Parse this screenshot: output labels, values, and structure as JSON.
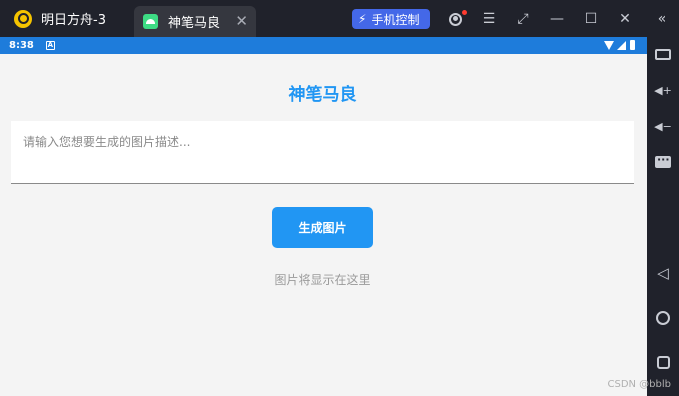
{
  "window": {
    "tabs": [
      {
        "label": "明日方舟-3"
      },
      {
        "label": "神笔马良"
      }
    ],
    "tab_close_glyph": "✕",
    "phone_control_label": "手机控制",
    "icons": [
      "user-icon",
      "menu-icon",
      "crop-icon",
      "minimize-icon",
      "maximize-icon",
      "close-icon",
      "collapse-icon"
    ]
  },
  "sidebar": {
    "icons": [
      "keyboard-icon",
      "volume-up-icon",
      "volume-down-icon",
      "more-icon",
      "back-icon",
      "home-icon",
      "recent-apps-icon"
    ]
  },
  "statusbar": {
    "time": "8:38",
    "badge": "A"
  },
  "app": {
    "title": "神笔马良",
    "input_placeholder": "请输入您想要生成的图片描述...",
    "generate_button": "生成图片",
    "image_placeholder": "图片将显示在这里"
  },
  "watermark": "CSDN @bblb",
  "colors": {
    "accent": "#2196f3",
    "statusbar": "#1e7cdb",
    "chrome": "#20222b",
    "phone_control": "#4468e8"
  }
}
